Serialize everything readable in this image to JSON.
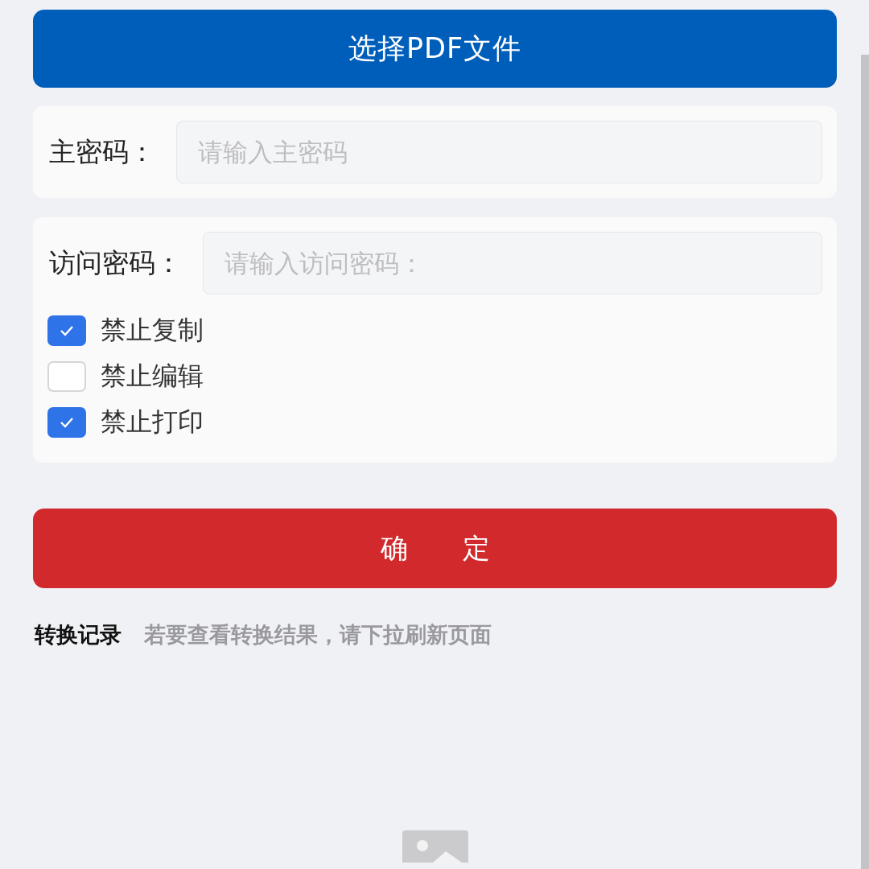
{
  "select_button": {
    "label": "选择PDF文件"
  },
  "master_password": {
    "label": "主密码：",
    "placeholder": "请输入主密码"
  },
  "access_password": {
    "label": "访问密码：",
    "placeholder": "请输入访问密码："
  },
  "permissions": [
    {
      "label": "禁止复制",
      "checked": true
    },
    {
      "label": "禁止编辑",
      "checked": false
    },
    {
      "label": "禁止打印",
      "checked": true
    }
  ],
  "confirm_button": {
    "label": "确　　定"
  },
  "records": {
    "title": "转换记录",
    "hint": "若要查看转换结果，请下拉刷新页面"
  }
}
